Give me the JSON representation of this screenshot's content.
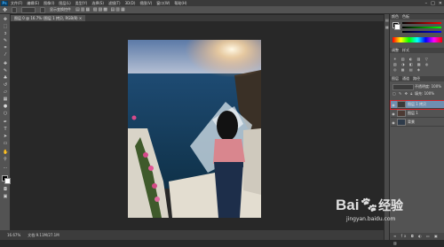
{
  "menu": {
    "app_badge": "Ps",
    "items": [
      "文件(F)",
      "编辑(E)",
      "图像(I)",
      "图层(L)",
      "类型(Y)",
      "选择(S)",
      "滤镜(T)",
      "3D(D)",
      "视图(V)",
      "窗口(W)",
      "帮助(H)"
    ]
  },
  "window_controls": {
    "minimize": "–",
    "maximize": "□",
    "close": "✕"
  },
  "options_bar": {
    "labels": [
      "",
      "",
      "显示变换控件"
    ]
  },
  "document_tab": {
    "title": "图层 0 @ 16.7% (图层 1 拷贝, RGB/8) ×"
  },
  "status": {
    "zoom": "16.67%",
    "doc_info": "文档:9.11M/27.1M"
  },
  "panels": {
    "color_tabs": [
      "颜色",
      "色板"
    ],
    "adjust_tabs": [
      "调整",
      "样式"
    ],
    "layers_tabs": [
      "图层",
      "通道",
      "路径"
    ],
    "opacity_label": "不透明度:",
    "opacity_value": "100%",
    "fill_label": "填充:",
    "fill_value": "100%",
    "layers": [
      {
        "name": "图层 1 拷贝",
        "selected": true
      },
      {
        "name": "图层 1",
        "selected": false
      },
      {
        "name": "背景",
        "selected": false
      }
    ],
    "foreground_color": "#000000",
    "background_color": "#ffffff",
    "highlight_color": "#d0262b"
  },
  "watermark": {
    "brand": "Bai",
    "brand2": "经验",
    "url": "jingyan.baidu.com"
  }
}
